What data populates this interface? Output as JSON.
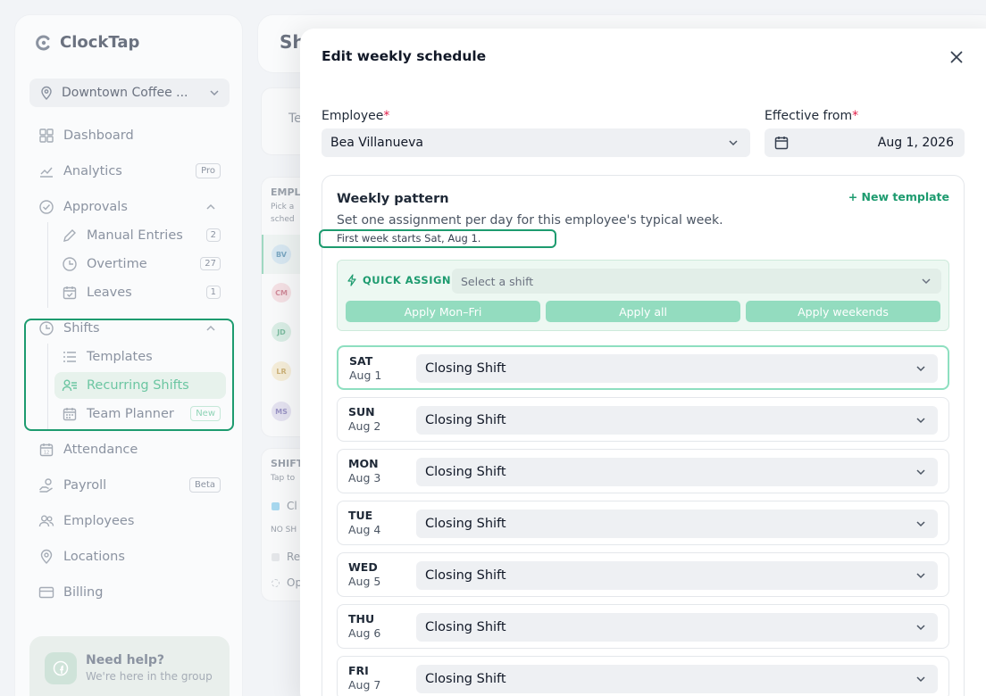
{
  "app": {
    "name": "ClockTap"
  },
  "sidebar": {
    "location": "Downtown Coffee ...",
    "nav": {
      "dashboard": "Dashboard",
      "analytics": "Analytics",
      "analytics_tag": "Pro",
      "approvals": "Approvals",
      "manual_entries": "Manual Entries",
      "manual_entries_count": "2",
      "overtime": "Overtime",
      "overtime_count": "27",
      "leaves": "Leaves",
      "leaves_count": "1",
      "shifts": "Shifts",
      "templates": "Templates",
      "recurring_shifts": "Recurring Shifts",
      "team_planner": "Team Planner",
      "team_planner_tag": "New",
      "attendance": "Attendance",
      "payroll": "Payroll",
      "payroll_tag": "Beta",
      "employees": "Employees",
      "locations": "Locations",
      "billing": "Billing"
    },
    "help": {
      "title": "Need help?",
      "subtitle": "We're here in the group"
    }
  },
  "background": {
    "page_title": "Sh",
    "search_fragment": "Te",
    "employees_header": "EMPL",
    "employees_hint_1": "Pick a",
    "employees_hint_2": "sched",
    "avatars": [
      "BV",
      "CM",
      "JD",
      "LR",
      "MS"
    ],
    "shift_header": "SHIFT",
    "shift_hint": "Tap to",
    "shift_item_1": "Cl",
    "no_shift": "NO SH",
    "shift_item_2": "Re",
    "shift_item_3": "Op"
  },
  "modal": {
    "title": "Edit weekly schedule",
    "employee_label": "Employee",
    "employee_value": "Bea Villanueva",
    "effective_label": "Effective from",
    "effective_value": "Aug 1, 2026",
    "required_mark": "*",
    "pattern": {
      "title": "Weekly pattern",
      "new_template": "+ New template",
      "description": "Set one assignment per day for this employee's typical week.",
      "hint": "First week starts Sat, Aug 1.",
      "quick_assign": {
        "label": "QUICK ASSIGN",
        "placeholder": "Select a shift",
        "apply_mon_fri": "Apply Mon–Fri",
        "apply_all": "Apply all",
        "apply_weekends": "Apply weekends"
      },
      "days": [
        {
          "day": "SAT",
          "date": "Aug 1",
          "shift": "Closing Shift"
        },
        {
          "day": "SUN",
          "date": "Aug 2",
          "shift": "Closing Shift"
        },
        {
          "day": "MON",
          "date": "Aug 3",
          "shift": "Closing Shift"
        },
        {
          "day": "TUE",
          "date": "Aug 4",
          "shift": "Closing Shift"
        },
        {
          "day": "WED",
          "date": "Aug 5",
          "shift": "Closing Shift"
        },
        {
          "day": "THU",
          "date": "Aug 6",
          "shift": "Closing Shift"
        },
        {
          "day": "FRI",
          "date": "Aug 7",
          "shift": "Closing Shift"
        }
      ]
    }
  },
  "colors": {
    "accent": "#1d9b6f",
    "required": "#e11d48",
    "quick_assign_button": "#93dcbf"
  }
}
